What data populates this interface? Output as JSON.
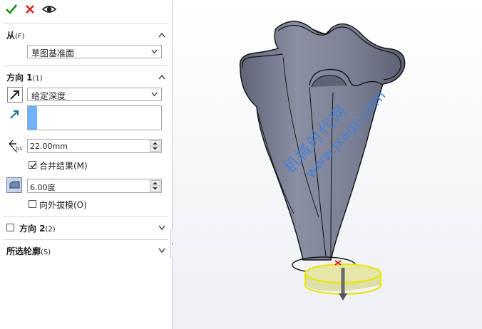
{
  "toolbar": {
    "ok_icon": "checkmark-icon",
    "cancel_icon": "x-icon",
    "preview_icon": "eye-icon"
  },
  "from": {
    "title": "从",
    "title_sub": "(F)",
    "select_value": "草图基准面"
  },
  "direction1": {
    "title": "方向 1",
    "title_sub": "(1)",
    "end_condition": "给定深度",
    "depth_value": "22.00mm",
    "merge_label": "合并结果(M)",
    "merge_checked": true,
    "draft_value": "6.00度",
    "draft_outward_label": "向外拔模(O)",
    "draft_outward_checked": false,
    "depth_badge": "D1"
  },
  "direction2": {
    "title": "方向 2",
    "title_sub": "(2)",
    "checked": false
  },
  "selected_contours": {
    "title": "所选轮廓",
    "title_sub": "(S)"
  },
  "watermark": {
    "line1": "机械时代网",
    "line2": "www.jxage.com"
  },
  "colors": {
    "accept": "#1a8a1a",
    "cancel": "#d0201a",
    "model": "#7d8296",
    "selection": "#e6e600",
    "watermark": "#3f7fe0"
  }
}
